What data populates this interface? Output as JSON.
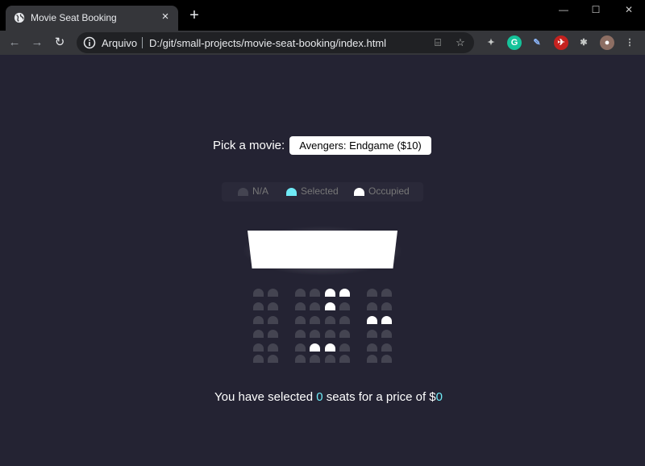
{
  "browser": {
    "tab_title": "Movie Seat Booking",
    "tab_close": "×",
    "new_tab": "+",
    "window": {
      "minimize": "—",
      "maximize": "☐",
      "close": "✕"
    },
    "nav": {
      "back": "←",
      "forward": "→",
      "reload": "↻"
    },
    "omnibox_label": "Arquivo",
    "url": "D:/git/small-projects/movie-seat-booking/index.html",
    "extensions": [
      "puzzle-icon",
      "grammarly-icon",
      "pen-icon",
      "ext-red-icon",
      "extensions-icon",
      "avatar-icon"
    ]
  },
  "page": {
    "picker_label": "Pick a movie:",
    "selected_movie": "Avengers: Endgame ($10)",
    "legend": [
      {
        "label": "N/A",
        "color": "#444451"
      },
      {
        "label": "Selected",
        "color": "#6feaf6"
      },
      {
        "label": "Occupied",
        "color": "#ffffff"
      }
    ],
    "seat_rows": [
      [
        "n",
        "n",
        "n",
        "n",
        "o",
        "o",
        "n",
        "n"
      ],
      [
        "n",
        "n",
        "n",
        "n",
        "o",
        "n",
        "n",
        "n"
      ],
      [
        "n",
        "n",
        "n",
        "n",
        "n",
        "n",
        "o",
        "o"
      ],
      [
        "n",
        "n",
        "n",
        "n",
        "n",
        "n",
        "n",
        "n"
      ],
      [
        "n",
        "n",
        "n",
        "o",
        "o",
        "n",
        "n",
        "n"
      ],
      [
        "n",
        "n",
        "n",
        "n",
        "n",
        "n",
        "n",
        "n"
      ]
    ],
    "summary": {
      "prefix": "You have selected ",
      "count": "0",
      "middle": " seats for a price of $",
      "total": "0"
    },
    "colors": {
      "background": "#242333",
      "accent": "#6feaf6",
      "seat": "#444451",
      "occupied": "#ffffff"
    }
  }
}
